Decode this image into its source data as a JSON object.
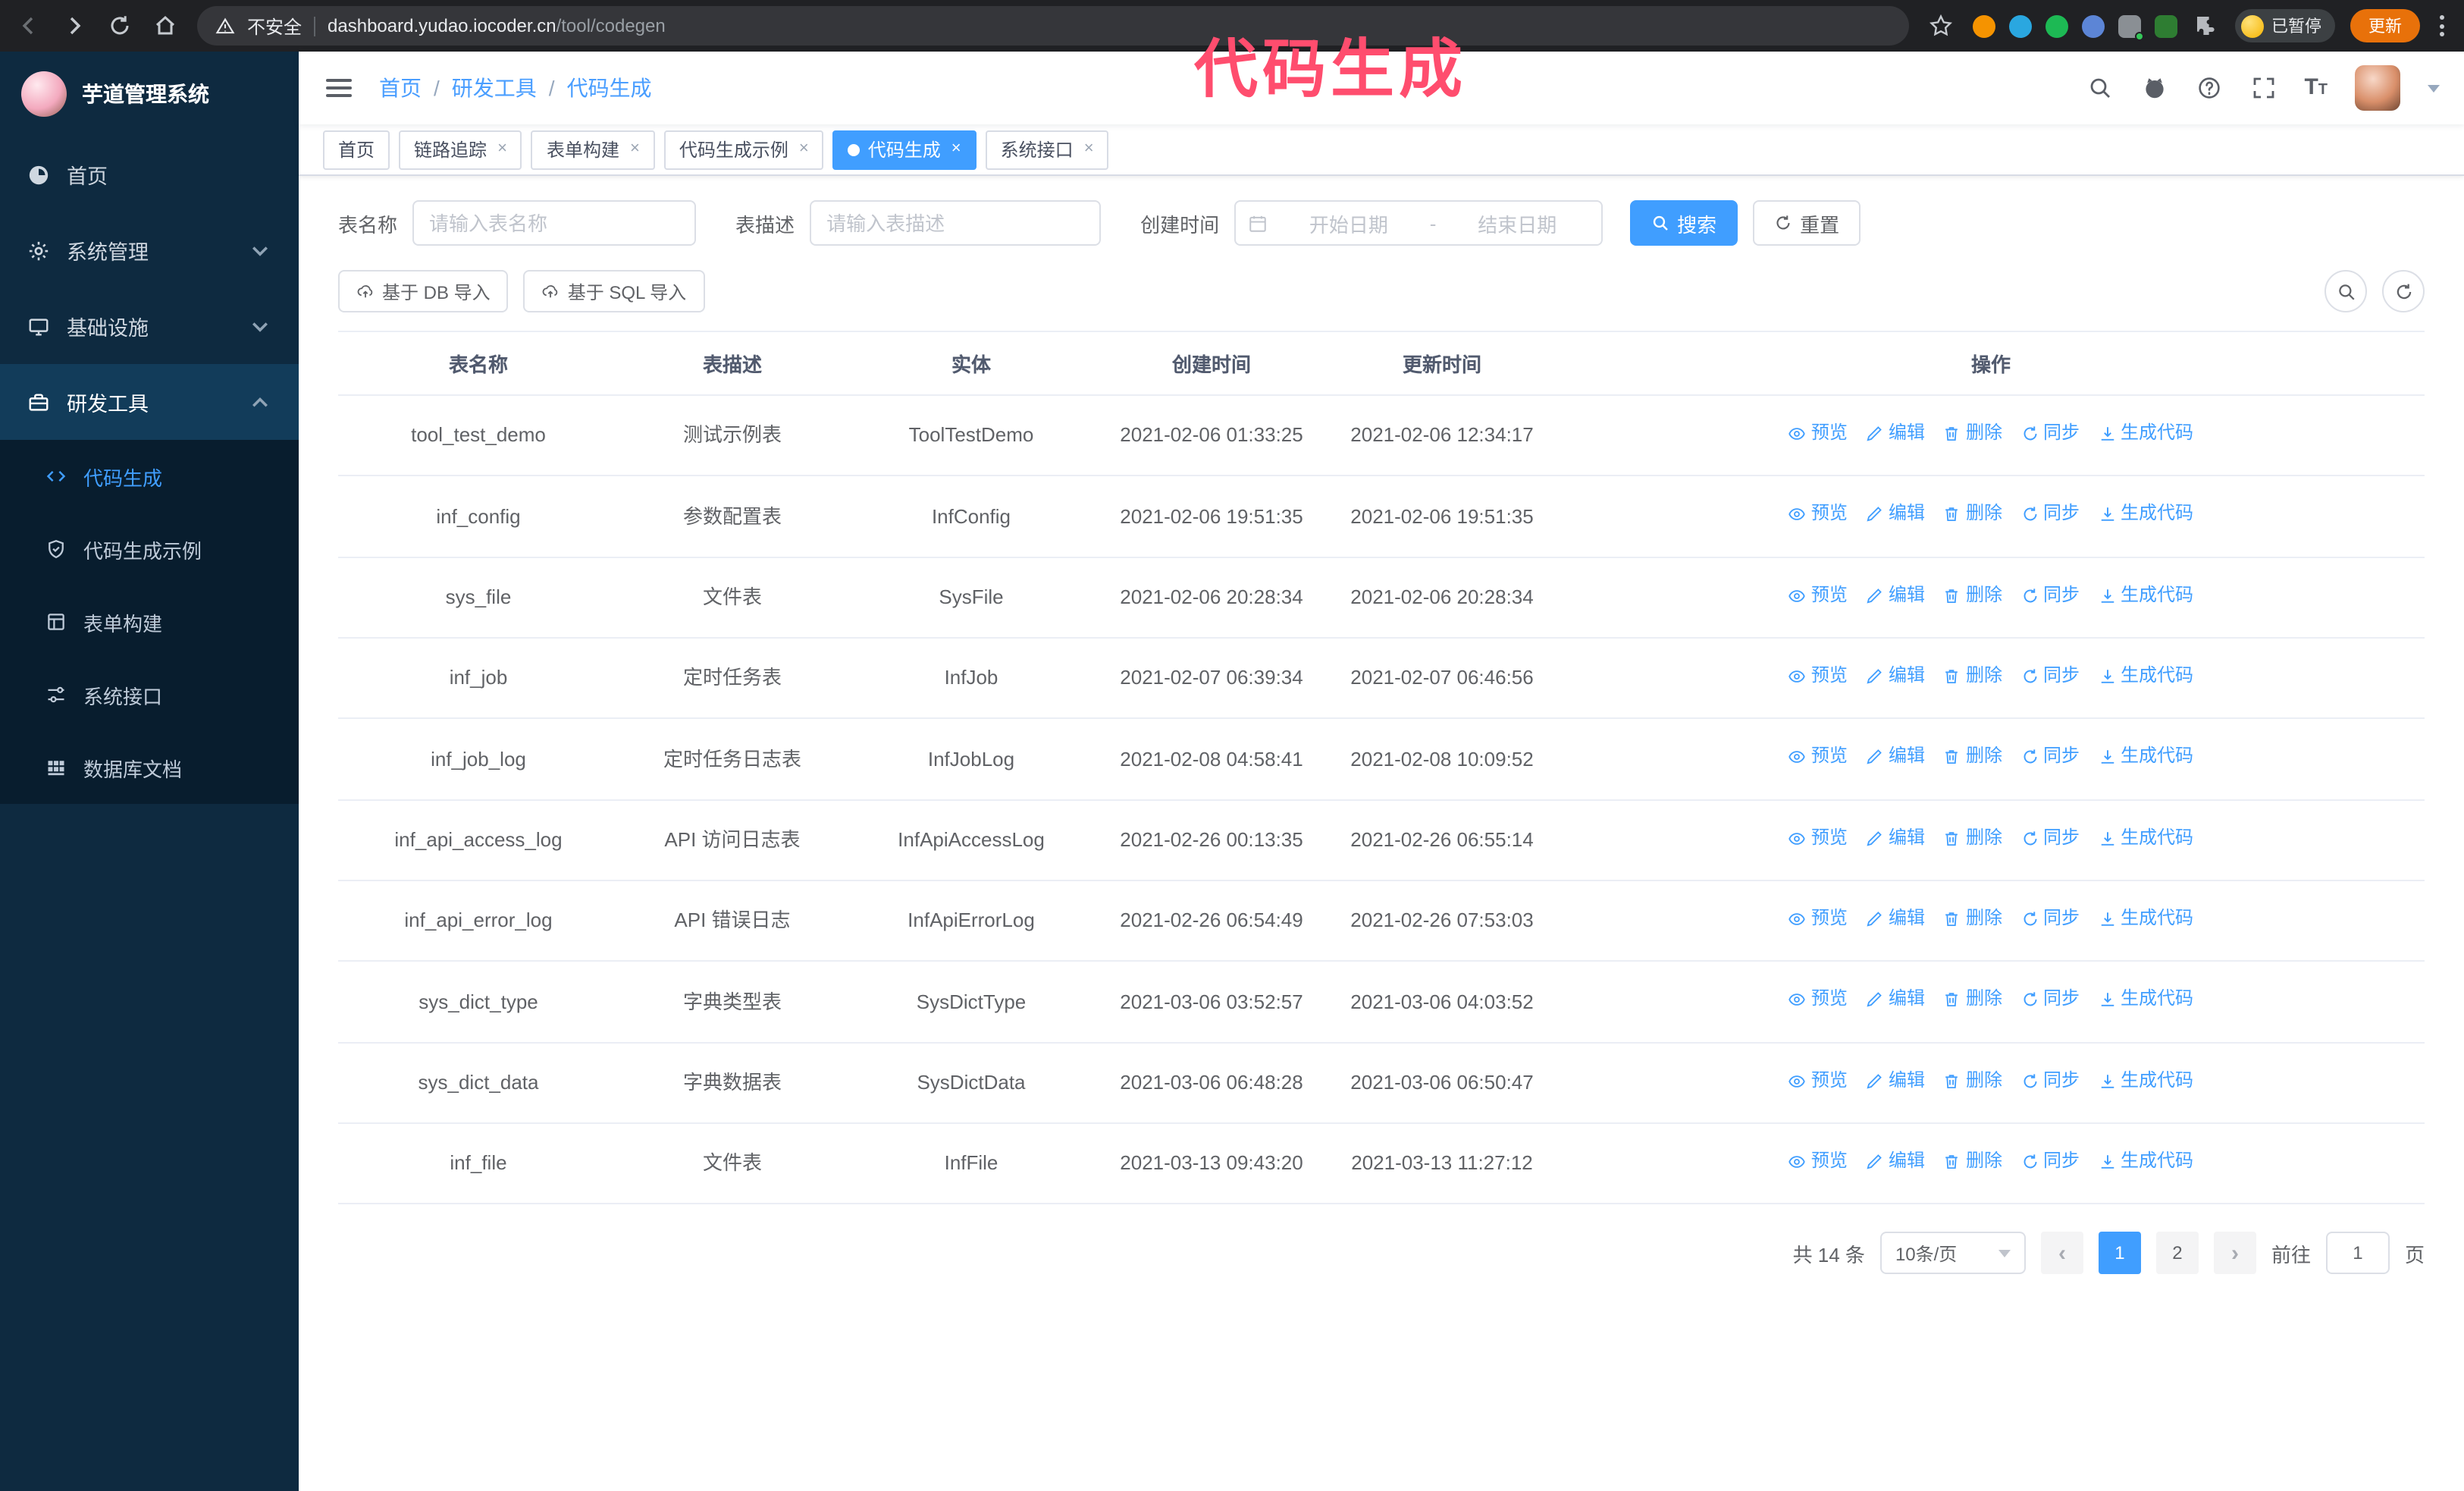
{
  "overlay": {
    "label": "代码生成"
  },
  "browser": {
    "security_warning": "不安全",
    "url_host": "dashboard.yudao.iocoder.cn",
    "url_path": "/tool/codegen",
    "paused_badge": "已暂停",
    "update_button": "更新",
    "extension_colors": [
      "#f59300",
      "#2aa7e0",
      "#1db954",
      "#5c85d6",
      "#8a8f94",
      "#2e7d32"
    ]
  },
  "sidebar": {
    "logo_title": "芋道管理系统",
    "items": [
      {
        "label": "首页"
      },
      {
        "label": "系统管理"
      },
      {
        "label": "基础设施"
      },
      {
        "label": "研发工具"
      }
    ],
    "sub_items": [
      {
        "label": "代码生成"
      },
      {
        "label": "代码生成示例"
      },
      {
        "label": "表单构建"
      },
      {
        "label": "系统接口"
      },
      {
        "label": "数据库文档"
      }
    ]
  },
  "header": {
    "breadcrumb": {
      "items": [
        "首页",
        "研发工具",
        "代码生成"
      ],
      "separator": "/"
    }
  },
  "tabs": [
    {
      "label": "首页"
    },
    {
      "label": "链路追踪"
    },
    {
      "label": "表单构建"
    },
    {
      "label": "代码生成示例"
    },
    {
      "label": "代码生成"
    },
    {
      "label": "系统接口"
    }
  ],
  "filters": {
    "table_name_label": "表名称",
    "table_name_placeholder": "请输入表名称",
    "table_desc_label": "表描述",
    "table_desc_placeholder": "请输入表描述",
    "create_time_label": "创建时间",
    "date_start_placeholder": "开始日期",
    "date_separator": "-",
    "date_end_placeholder": "结束日期",
    "search_button": "搜索",
    "reset_button": "重置"
  },
  "toolbar": {
    "import_db_button": "基于 DB 导入",
    "import_sql_button": "基于 SQL 导入"
  },
  "table": {
    "columns": [
      "表名称",
      "表描述",
      "实体",
      "创建时间",
      "更新时间",
      "操作"
    ],
    "actions": [
      {
        "label": "预览",
        "name": "preview",
        "icon": "eye"
      },
      {
        "label": "编辑",
        "name": "edit",
        "icon": "edit"
      },
      {
        "label": "删除",
        "name": "delete",
        "icon": "del"
      },
      {
        "label": "同步",
        "name": "sync",
        "icon": "sync"
      },
      {
        "label": "生成代码",
        "name": "generate-code",
        "icon": "gen"
      }
    ],
    "rows": [
      {
        "name": "tool_test_demo",
        "desc": "测试示例表",
        "entity": "ToolTestDemo",
        "created": "2021-02-06 01:33:25",
        "updated": "2021-02-06 12:34:17"
      },
      {
        "name": "inf_config",
        "desc": "参数配置表",
        "entity": "InfConfig",
        "created": "2021-02-06 19:51:35",
        "updated": "2021-02-06 19:51:35"
      },
      {
        "name": "sys_file",
        "desc": "文件表",
        "entity": "SysFile",
        "created": "2021-02-06 20:28:34",
        "updated": "2021-02-06 20:28:34"
      },
      {
        "name": "inf_job",
        "desc": "定时任务表",
        "entity": "InfJob",
        "created": "2021-02-07 06:39:34",
        "updated": "2021-02-07 06:46:56"
      },
      {
        "name": "inf_job_log",
        "desc": "定时任务日志表",
        "entity": "InfJobLog",
        "created": "2021-02-08 04:58:41",
        "updated": "2021-02-08 10:09:52"
      },
      {
        "name": "inf_api_access_log",
        "desc": "API 访问日志表",
        "entity": "InfApiAccessLog",
        "created": "2021-02-26 00:13:35",
        "updated": "2021-02-26 06:55:14"
      },
      {
        "name": "inf_api_error_log",
        "desc": "API 错误日志",
        "entity": "InfApiErrorLog",
        "created": "2021-02-26 06:54:49",
        "updated": "2021-02-26 07:53:03"
      },
      {
        "name": "sys_dict_type",
        "desc": "字典类型表",
        "entity": "SysDictType",
        "created": "2021-03-06 03:52:57",
        "updated": "2021-03-06 04:03:52"
      },
      {
        "name": "sys_dict_data",
        "desc": "字典数据表",
        "entity": "SysDictData",
        "created": "2021-03-06 06:48:28",
        "updated": "2021-03-06 06:50:47"
      },
      {
        "name": "inf_file",
        "desc": "文件表",
        "entity": "InfFile",
        "created": "2021-03-13 09:43:20",
        "updated": "2021-03-13 11:27:12"
      }
    ]
  },
  "pagination": {
    "total_text": "共 14 条",
    "page_size": "10条/页",
    "pages": [
      "1",
      "2"
    ],
    "active_page": "1",
    "goto_prefix": "前往",
    "goto_value": "1",
    "goto_suffix": "页"
  },
  "colors": {
    "primary": "#409eff",
    "sidebar_bg": "#0e2a40",
    "overlay_pink": "#ff4d6e"
  }
}
